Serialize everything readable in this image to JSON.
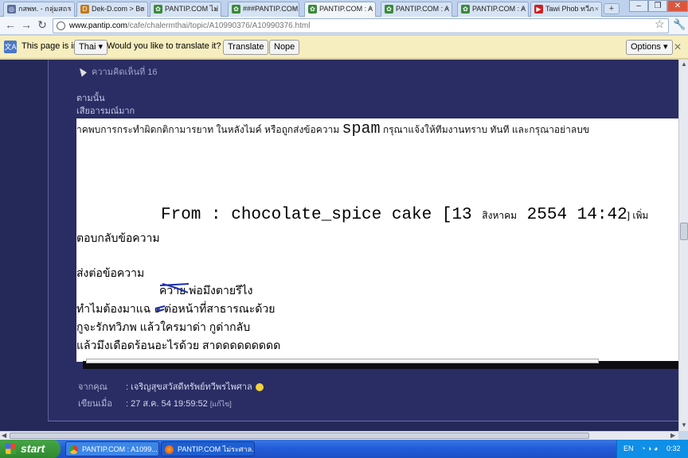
{
  "tabs": [
    {
      "label": "กสพท. - กลุ่มสถา",
      "fav": "◎",
      "color": "#5a6f9c"
    },
    {
      "label": "Dek-D.com > Bo",
      "fav": "D",
      "color": "#c07a1c"
    },
    {
      "label": "PANTIP.COM ไม่",
      "fav": "✿",
      "color": "#3a8a3a"
    },
    {
      "label": "###PANTIP.COM",
      "fav": "✿",
      "color": "#3a8a3a"
    },
    {
      "label": "PANTIP.COM : A",
      "fav": "✿",
      "color": "#3a8a3a"
    },
    {
      "label": "PANTIP.COM : A",
      "fav": "✿",
      "color": "#3a8a3a"
    },
    {
      "label": "PANTIP.COM : A",
      "fav": "✿",
      "color": "#3a8a3a"
    },
    {
      "label": "Tawi Phob ทวีภ",
      "fav": "▶",
      "color": "#cc2020"
    }
  ],
  "new_tab": "+",
  "window_buttons": [
    "–",
    "❐",
    "✕"
  ],
  "address": {
    "domain": "www.pantip.com",
    "path": "/cafe/chalermthai/topic/A10990376/A10990376.html"
  },
  "translate_bar": {
    "icon": "文A",
    "page_is_in": "This page is in",
    "language": "Thai ▾",
    "question": "Would you like to translate it?",
    "translate": "Translate",
    "nope": "Nope",
    "options": "Options ▾",
    "close": "✕"
  },
  "comment": {
    "header": "ความคิดเห็นที่ 16",
    "line1": "ตามนั้น",
    "line2": "เสียอารมณ์มาก",
    "warning_pre": "าคพบการกระทำผิดกติกามารยาท ในหลังไมค์ หรือถูกส่งข้อความ ",
    "warning_spam": "spam",
    "warning_post": " กรุณาแจ้งให้ทีมงานทราบ ทันที และกรุณาอย่าลบข",
    "from_prefix": "From : chocolate_spice cake [13 ",
    "from_month": "สิงหาคม",
    "from_date": " 2554 14:42",
    "from_tail": "] เพิ่ม",
    "reply_link": "ตอบกลับข้อความ",
    "send_link": "ส่งต่อข้อความ",
    "body1": "ควาย พ่อมึงตายรึไง",
    "body2": "ทำไมต้องมาแฉ ๑ ต่อหน้าที่สาธารณะด้วย",
    "body3": "กูจะรักทวิภพ แล้วใครมาด่า กูด่ากลับ",
    "body4": "แล้วมึงเดือดร้อนอะไรด้วย สาดดดดดดดดด",
    "from_label": "จากคุณ",
    "author": ": เจริญสุขสวัสดีทรัพย์ทวีพรไพศาล",
    "posted_label": "เขียนเมื่อ",
    "posted": ": 27 ส.ค. 54 19:59:52",
    "edit": "[แก้ไข]"
  },
  "taskbar": {
    "start": "start",
    "tasks": [
      {
        "label": "PANTIP.COM : A1099...",
        "color": "#3c86e8"
      },
      {
        "label": "PANTIP.COM ไม่ระศาล...",
        "color": "#1e5fd0"
      }
    ],
    "lang": "EN",
    "time": "0:32"
  }
}
